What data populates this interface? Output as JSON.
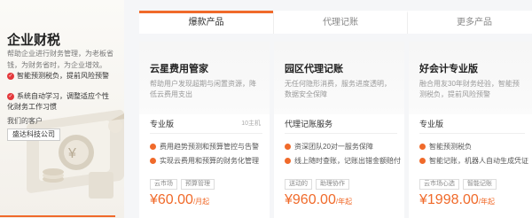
{
  "promo": {
    "title": "企业财税",
    "desc": "帮助企业进行财务管理，为老板省钱，为财务省时，为企业增效。",
    "features": [
      "智能预测税负，提前风险预警",
      "系统自动学习，调整适应个性化财务工作习惯"
    ],
    "clients_title": "我们的客户",
    "client_name": "盛达科技公司"
  },
  "tabs": [
    {
      "label": "爆款产品",
      "active": true
    },
    {
      "label": "代理记账",
      "active": false
    },
    {
      "label": "更多产品",
      "active": false
    }
  ],
  "cards": [
    {
      "name": "云星费用管家",
      "summary": "帮助用户发现超期与闲置资源，降低云费用支出",
      "edition": "专业版",
      "edition_sub": "10主机",
      "features": [
        "费用趋势预测和预算管控与告警",
        "实现云费用和预算的财务化管理"
      ],
      "tags": [
        "云市场",
        "预算管理"
      ],
      "price": "¥60.00",
      "price_unit": "/月起"
    },
    {
      "name": "园区代理记账",
      "summary": "无任何隐形消费，服务进度透明，数据安全保障",
      "edition": "代理记账服务",
      "edition_sub": "",
      "features": [
        "资深团队20对一服务保障",
        "线上随时查账，记账出错金额赔付"
      ],
      "tags": [
        "送动的",
        "助理协作"
      ],
      "price": "¥960.00",
      "price_unit": "/年起"
    },
    {
      "name": "好会计专业版",
      "summary": "融合用友30年财务经验，智能预测税负，提前风险预警",
      "edition": "专业版",
      "edition_sub": "",
      "features": [
        "智能预测税负",
        "智能记账，机器人自动生成凭证"
      ],
      "tags": [
        "云市场心选",
        "智能记账"
      ],
      "price": "¥1998.00",
      "price_unit": "/年起"
    }
  ],
  "colors": {
    "accent": "#f06a2a",
    "check": "#e4393c"
  }
}
